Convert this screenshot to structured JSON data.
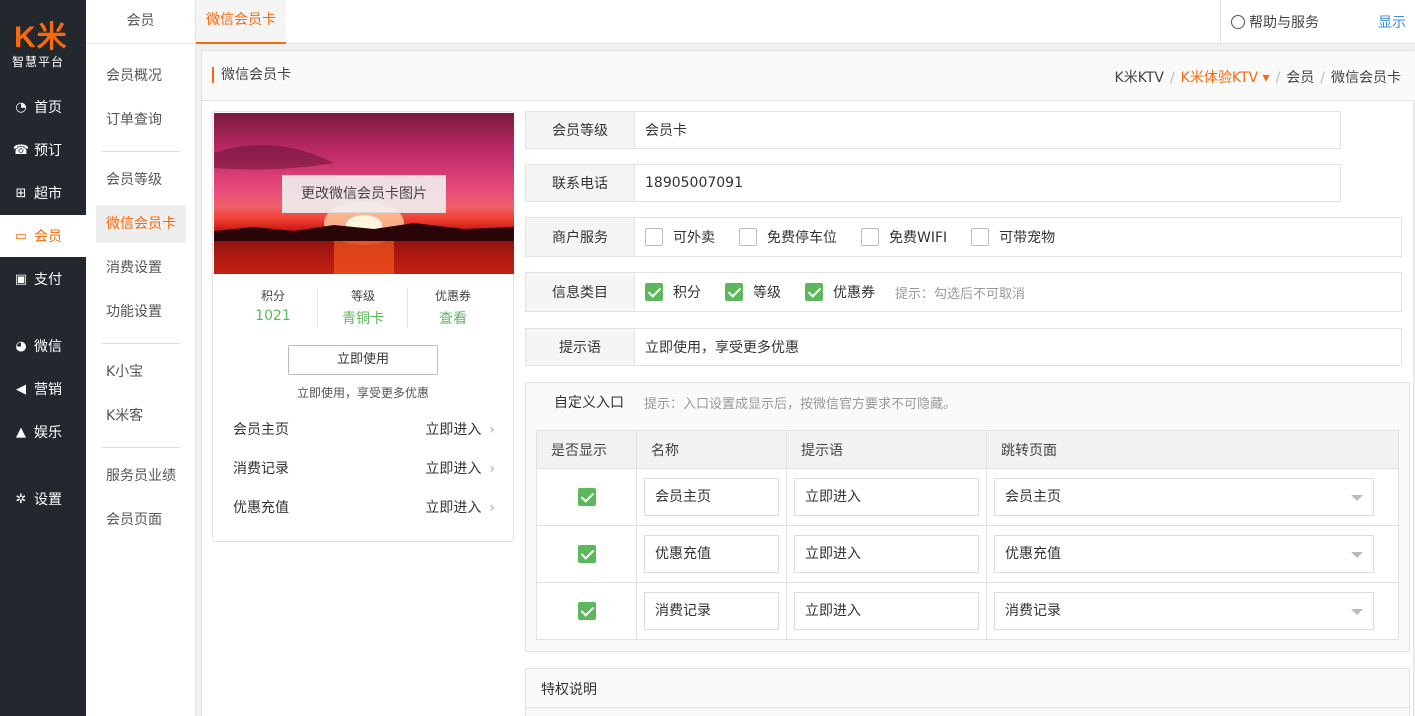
{
  "brand": {
    "logo": "K米",
    "subtitle": "智慧平台",
    "accent": "#f96a0e"
  },
  "leftnav": [
    {
      "label": "首页",
      "icon": "dashboard-icon"
    },
    {
      "label": "预订",
      "icon": "phone-icon"
    },
    {
      "label": "超市",
      "icon": "basket-icon"
    },
    {
      "label": "会员",
      "icon": "card-icon"
    },
    {
      "label": "支付",
      "icon": "money-icon"
    },
    {
      "label": "微信",
      "icon": "wechat-icon"
    },
    {
      "label": "营销",
      "icon": "megaphone-icon"
    },
    {
      "label": "娱乐",
      "icon": "lock-icon"
    },
    {
      "label": "设置",
      "icon": "gear-icon"
    }
  ],
  "subnav": {
    "header": "会员",
    "items": [
      "会员概况",
      "订单查询",
      "会员等级",
      "微信会员卡",
      "消费设置",
      "功能设置",
      "K小宝",
      "K米客",
      "服务员业绩",
      "会员页面"
    ]
  },
  "topbar": {
    "tab": "微信会员卡",
    "help": "帮助与服务",
    "display": "显示"
  },
  "page": {
    "title": "微信会员卡",
    "breadcrumb": [
      "K米KTV",
      "K米体验KTV",
      "会员",
      "微信会员卡"
    ]
  },
  "card": {
    "change_image": "更改微信会员卡图片",
    "stats": [
      {
        "label": "积分",
        "value": "1021"
      },
      {
        "label": "等级",
        "value": "青铜卡"
      },
      {
        "label": "优惠券",
        "value": "查看"
      }
    ],
    "use_button": "立即使用",
    "use_hint": "立即使用，享受更多优惠",
    "links": [
      {
        "label": "会员主页",
        "action": "立即进入"
      },
      {
        "label": "消费记录",
        "action": "立即进入"
      },
      {
        "label": "优惠充值",
        "action": "立即进入"
      }
    ]
  },
  "form": {
    "level": {
      "label": "会员等级",
      "value": "会员卡"
    },
    "phone": {
      "label": "联系电话",
      "value": "18905007091"
    },
    "services": {
      "label": "商户服务",
      "options": [
        {
          "label": "可外卖",
          "checked": false
        },
        {
          "label": "免费停车位",
          "checked": false
        },
        {
          "label": "免费WIFI",
          "checked": false
        },
        {
          "label": "可带宠物",
          "checked": false
        }
      ]
    },
    "info": {
      "label": "信息类目",
      "options": [
        {
          "label": "积分",
          "checked": true
        },
        {
          "label": "等级",
          "checked": true
        },
        {
          "label": "优惠券",
          "checked": true
        }
      ],
      "hint": "提示：勾选后不可取消"
    },
    "tip": {
      "label": "提示语",
      "value": "立即使用，享受更多优惠"
    }
  },
  "entry": {
    "title": "自定义入口",
    "hint": "提示：入口设置成显示后，按微信官方要求不可隐藏。",
    "columns": [
      "是否显示",
      "名称",
      "提示语",
      "跳转页面"
    ],
    "rows": [
      {
        "show": true,
        "name": "会员主页",
        "tip": "立即进入",
        "page": "会员主页"
      },
      {
        "show": true,
        "name": "优惠充值",
        "tip": "立即进入",
        "page": "优惠充值"
      },
      {
        "show": true,
        "name": "消费记录",
        "tip": "立即进入",
        "page": "消费记录"
      }
    ]
  },
  "privilege": {
    "title": "特权说明"
  }
}
